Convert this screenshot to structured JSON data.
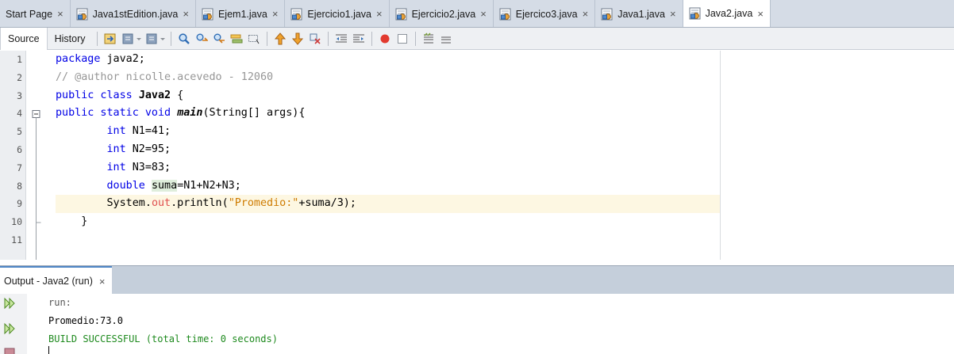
{
  "editor_tabs": [
    {
      "label": "Start Page",
      "has_icon": false,
      "active": false
    },
    {
      "label": "Java1stEdition.java",
      "has_icon": true,
      "active": false
    },
    {
      "label": "Ejem1.java",
      "has_icon": true,
      "active": false
    },
    {
      "label": "Ejercicio1.java",
      "has_icon": true,
      "active": false
    },
    {
      "label": "Ejercicio2.java",
      "has_icon": true,
      "active": false
    },
    {
      "label": "Ejercico3.java",
      "has_icon": true,
      "active": false
    },
    {
      "label": "Java1.java",
      "has_icon": true,
      "active": false
    },
    {
      "label": "Java2.java",
      "has_icon": true,
      "active": true
    }
  ],
  "tab_close_glyph": "×",
  "toolbar": {
    "source_label": "Source",
    "history_label": "History",
    "icons": [
      "last-edit-icon",
      "back-icon",
      "forward-icon",
      "find-icon",
      "find-previous-icon",
      "find-next-icon",
      "toggle-highlight-icon",
      "toggle-rectangular-selection-icon",
      "previous-bookmark-icon",
      "next-bookmark-icon",
      "toggle-bookmark-icon",
      "shift-left-icon",
      "shift-right-icon",
      "start-macro-icon",
      "stop-macro-icon",
      "comment-icon",
      "uncomment-icon"
    ]
  },
  "editor": {
    "line_numbers": [
      "1",
      "2",
      "3",
      "4",
      "5",
      "6",
      "7",
      "8",
      "9",
      "10",
      "11"
    ],
    "current_line": 9,
    "lines": [
      [
        {
          "t": "package",
          "c": "kw"
        },
        {
          "t": " java2;",
          "c": ""
        }
      ],
      [
        {
          "t": "// @author nicolle.acevedo - 12060",
          "c": "cm"
        }
      ],
      [
        {
          "t": "public class ",
          "c": "kw"
        },
        {
          "t": "Java2",
          "c": "bold"
        },
        {
          "t": " {",
          "c": ""
        }
      ],
      [
        {
          "t": "public static void ",
          "c": "kw"
        },
        {
          "t": "main",
          "c": "boldit"
        },
        {
          "t": "(String[] args){",
          "c": ""
        }
      ],
      [
        {
          "t": "        int",
          "c": "kw"
        },
        {
          "t": " N1=41;",
          "c": ""
        }
      ],
      [
        {
          "t": "        int",
          "c": "kw"
        },
        {
          "t": " N2=95;",
          "c": ""
        }
      ],
      [
        {
          "t": "        int",
          "c": "kw"
        },
        {
          "t": " N3=83;",
          "c": ""
        }
      ],
      [
        {
          "t": "        double ",
          "c": "kw"
        },
        {
          "t": "suma",
          "c": "mark"
        },
        {
          "t": "=N1+N2+N3;",
          "c": ""
        }
      ],
      [
        {
          "t": "        System.",
          "c": ""
        },
        {
          "t": "out",
          "c": "fld"
        },
        {
          "t": ".println(",
          "c": ""
        },
        {
          "t": "\"Promedio:\"",
          "c": "str"
        },
        {
          "t": "+suma/3);",
          "c": ""
        }
      ],
      [
        {
          "t": "    }",
          "c": ""
        }
      ],
      [
        {
          "t": "",
          "c": ""
        }
      ]
    ]
  },
  "output": {
    "tab_label": "Output - Java2 (run)",
    "lines": [
      {
        "text": "run:",
        "style": "out-run"
      },
      {
        "text": "Promedio:73.0",
        "style": "out-plain"
      },
      {
        "text": "BUILD SUCCESSFUL (total time: 0 seconds)",
        "style": "out-success"
      }
    ],
    "side_icons": [
      "rerun-icon",
      "rerun-with-options-icon",
      "stop-icon"
    ]
  },
  "colors": {
    "keyword": "#0000e6",
    "comment": "#969696",
    "string": "#ce7b00",
    "field": "#e05050",
    "success": "#1e8a1e",
    "current_line": "#fdf7e2",
    "active_tab_accent": "#4f86c6"
  }
}
